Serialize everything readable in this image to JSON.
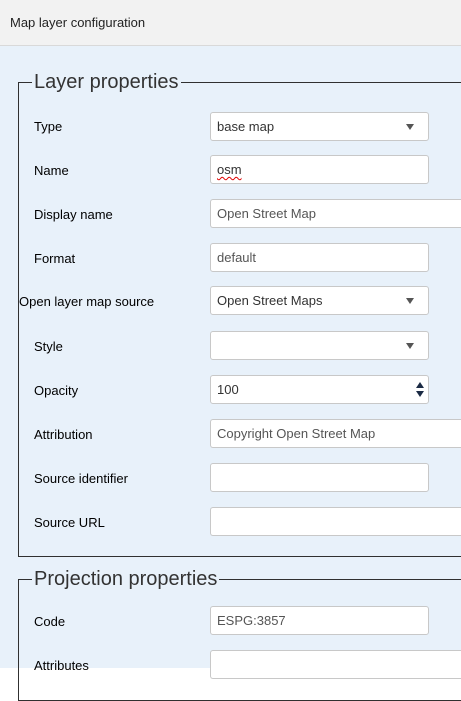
{
  "header": {
    "title": "Map layer configuration"
  },
  "layer_properties": {
    "legend": "Layer properties",
    "type": {
      "label": "Type",
      "value": "base map"
    },
    "name": {
      "label": "Name",
      "value": "osm"
    },
    "display_name": {
      "label": "Display name",
      "value": "Open Street Map"
    },
    "format": {
      "label": "Format",
      "value": "default"
    },
    "open_layer_map_source": {
      "label": "Open layer map source",
      "value": "Open Street Maps"
    },
    "style": {
      "label": "Style",
      "value": ""
    },
    "opacity": {
      "label": "Opacity",
      "value": "100"
    },
    "attribution": {
      "label": "Attribution",
      "value": "Copyright Open Street Map"
    },
    "source_identifier": {
      "label": "Source identifier",
      "value": ""
    },
    "source_url": {
      "label": "Source URL",
      "value": ""
    }
  },
  "projection_properties": {
    "legend": "Projection properties",
    "code": {
      "label": "Code",
      "value": "ESPG:3857"
    },
    "attributes": {
      "label": "Attributes",
      "value": ""
    }
  },
  "icons": [
    "dropdown-caret-icon",
    "spinner-up-icon",
    "spinner-down-icon"
  ],
  "colors": {
    "panel_bg": "#e8f1fa",
    "header_bg": "#f2f2f2",
    "field_border": "#c8c8c8"
  }
}
